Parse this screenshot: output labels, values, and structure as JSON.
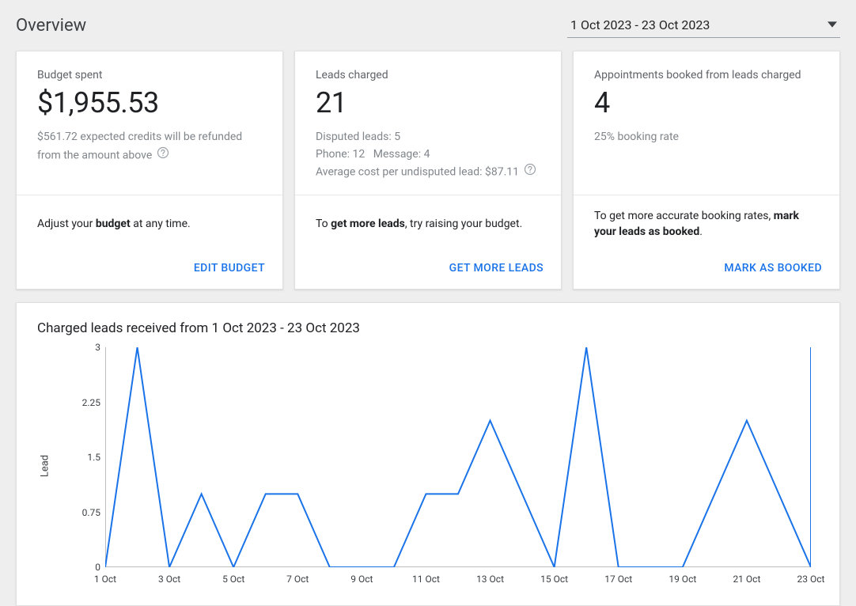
{
  "header": {
    "title": "Overview",
    "date_range": "1 Oct 2023 - 23 Oct 2023"
  },
  "cards": {
    "budget": {
      "label": "Budget spent",
      "value": "$1,955.53",
      "note": "$561.72 expected credits will be refunded from the amount above",
      "hint_html": "Adjust your <b>budget</b> at any time.",
      "action": "EDIT BUDGET"
    },
    "leads": {
      "label": "Leads charged",
      "value": "21",
      "disputed": "Disputed leads: 5",
      "phone": "Phone: 12",
      "message": "Message: 4",
      "avg_cost": "Average cost per undisputed lead: $87.11",
      "hint_html": "To <b>get more leads</b>, try raising your budget.",
      "action": "GET MORE LEADS"
    },
    "appts": {
      "label": "Appointments booked from leads charged",
      "value": "4",
      "rate": "25% booking rate",
      "hint_html": "To get more accurate booking rates, <b>mark your leads as booked</b>.",
      "action": "MARK AS BOOKED"
    }
  },
  "chart": {
    "title": "Charged leads received from 1 Oct 2023 - 23 Oct 2023",
    "ylabel": "Lead"
  },
  "chart_data": {
    "type": "line",
    "xlabel": "",
    "ylabel": "Lead",
    "ylim": [
      0,
      3
    ],
    "y_ticks": [
      0,
      0.75,
      1.5,
      2.25,
      3
    ],
    "x_tick_labels": [
      "1 Oct",
      "3 Oct",
      "5 Oct",
      "7 Oct",
      "9 Oct",
      "11 Oct",
      "13 Oct",
      "15 Oct",
      "17 Oct",
      "19 Oct",
      "21 Oct",
      "23 Oct"
    ],
    "categories": [
      "1 Oct",
      "2 Oct",
      "3 Oct",
      "4 Oct",
      "5 Oct",
      "6 Oct",
      "7 Oct",
      "8 Oct",
      "9 Oct",
      "10 Oct",
      "11 Oct",
      "12 Oct",
      "13 Oct",
      "14 Oct",
      "15 Oct",
      "16 Oct",
      "17 Oct",
      "18 Oct",
      "19 Oct",
      "20 Oct",
      "21 Oct",
      "22 Oct",
      "23 Oct"
    ],
    "values": [
      0,
      3,
      0,
      1,
      0,
      1,
      1,
      0,
      0,
      0,
      1,
      1,
      2,
      1,
      0,
      3,
      0,
      0,
      0,
      1,
      2,
      1,
      0
    ],
    "post_values": {
      "22": 3
    },
    "title": "Charged leads received from 1 Oct 2023 - 23 Oct 2023",
    "color": "#1a73e8"
  }
}
